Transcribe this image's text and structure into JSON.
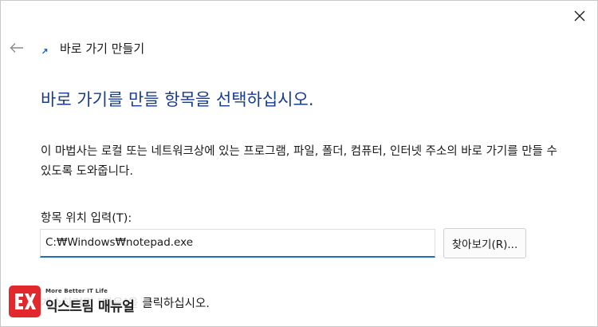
{
  "window": {
    "close_glyph": "✕"
  },
  "header": {
    "back_icon": "arrow-left-icon",
    "title": "바로 가기 만들기"
  },
  "main": {
    "heading": "바로 가기를 만들 항목을 선택하십시오.",
    "description": "이 마법사는 로컬 또는 네트워크상에 있는 프로그램, 파일, 폴더, 컴퓨터, 인터넷 주소의 바로 가기를 만들 수 있도록 도와줍니다.",
    "field_label": "항목 위치 입력(T):",
    "location_value": "C:₩Windows₩notepad.exe",
    "browse_label": "찾아보기(R)...",
    "footer_instruction": "계속하려면 [다음]을 클릭하십시오."
  },
  "watermark": {
    "tagline": "More Better IT Life",
    "name": "익스트림 매뉴얼"
  },
  "colors": {
    "heading": "#1a3c8c",
    "input_focus": "#1f6fb6",
    "watermark_logo": "#e2282c"
  }
}
